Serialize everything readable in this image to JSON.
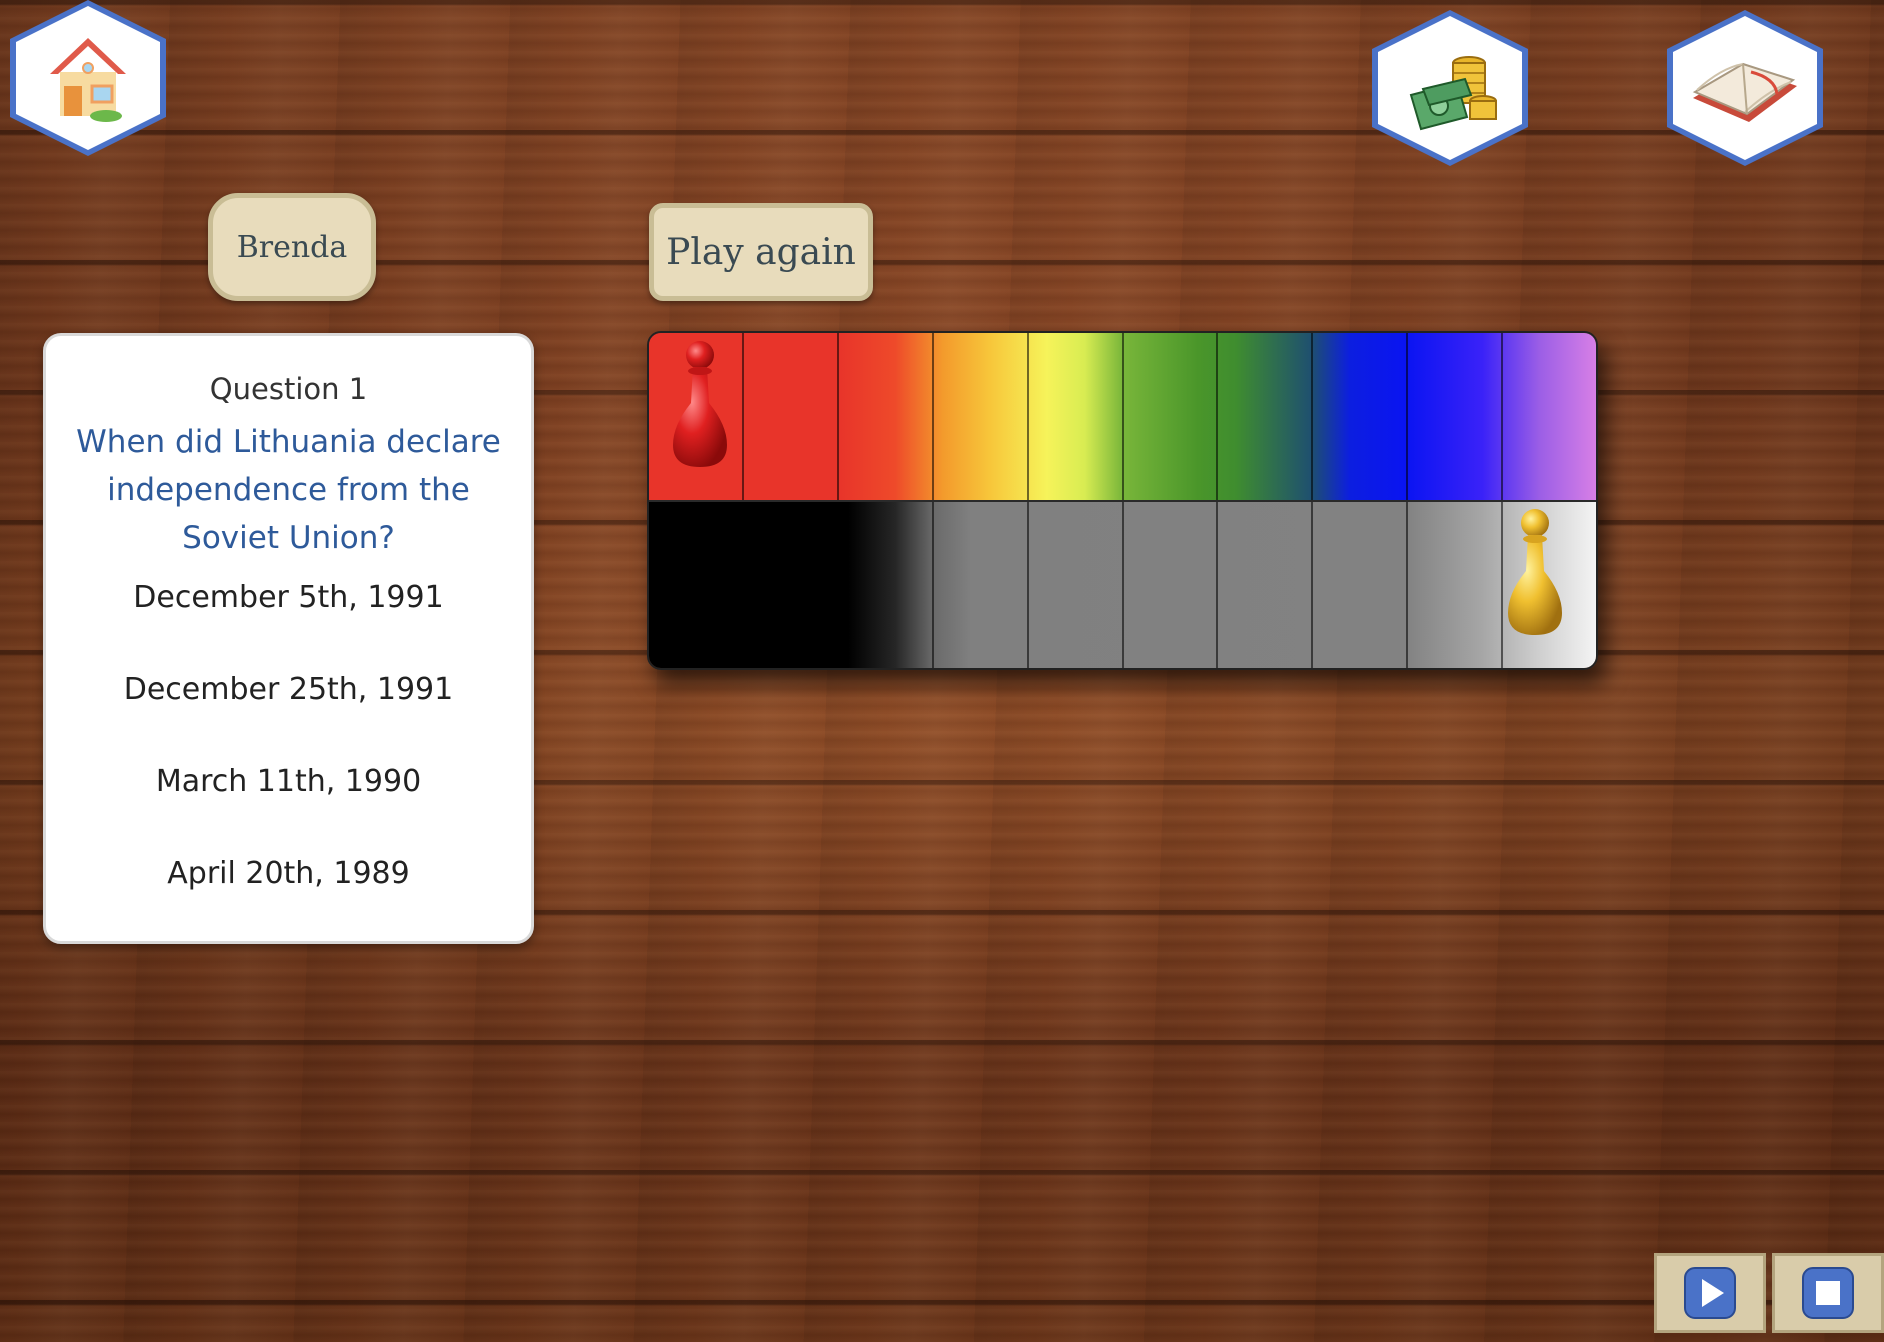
{
  "player": {
    "name": "Brenda"
  },
  "controls": {
    "play_again_label": "Play again"
  },
  "question": {
    "number_label": "Question 1",
    "text": "When did Lithuania declare independence from the Soviet Union?",
    "answers": [
      "December 5th, 1991",
      "December 25th, 1991",
      "March 11th, 1990",
      "April 20th, 1989"
    ]
  },
  "board": {
    "columns": 10,
    "rows": 2,
    "pieces": [
      {
        "color": "red",
        "row": 1,
        "column": 1
      },
      {
        "color": "yellow",
        "row": 2,
        "column": 10
      }
    ]
  },
  "icons": {
    "home": "home-icon",
    "money": "money-icon",
    "book": "book-icon",
    "play": "play-icon",
    "stop": "stop-icon"
  },
  "colors": {
    "hex_border": "#4a72c8",
    "chip_fill": "#e8dcbc",
    "question_text": "#2e5a9a",
    "media_button_fill": "#d9ccaa",
    "media_icon": "#4a72c8"
  }
}
